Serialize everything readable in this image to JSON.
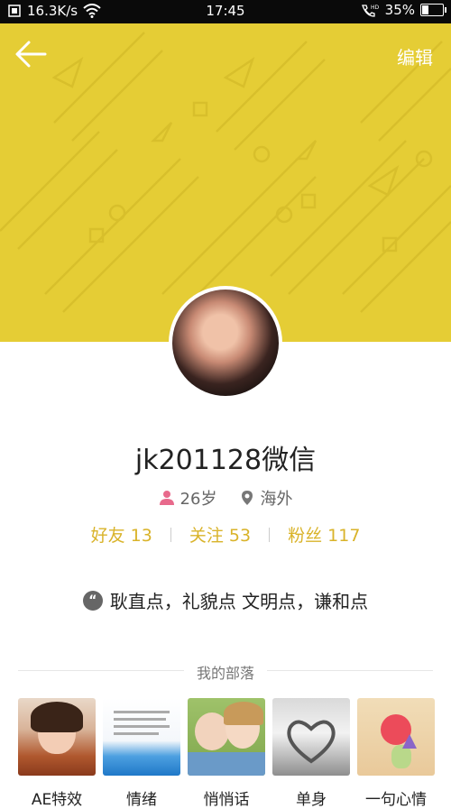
{
  "status_bar": {
    "speed": "16.3K/s",
    "time": "17:45",
    "battery": "35%",
    "battery_level": 0.35
  },
  "header": {
    "edit_label": "编辑",
    "background_color": "#e5cd35"
  },
  "profile": {
    "name": "jk201128微信",
    "age": "26岁",
    "location": "海外",
    "stats": [
      {
        "label": "好友",
        "value": "13"
      },
      {
        "label": "关注",
        "value": "53"
      },
      {
        "label": "粉丝",
        "value": "117"
      }
    ],
    "signature": "耿直点，礼貌点 文明点，谦和点"
  },
  "tribes_section": {
    "title": "我的部落",
    "items": [
      {
        "label": "AE特效"
      },
      {
        "label": "情绪"
      },
      {
        "label": "悄悄话"
      },
      {
        "label": "单身"
      },
      {
        "label": "一句心情"
      }
    ]
  },
  "colors": {
    "accent": "#d9b32a",
    "header": "#e5cd35"
  }
}
